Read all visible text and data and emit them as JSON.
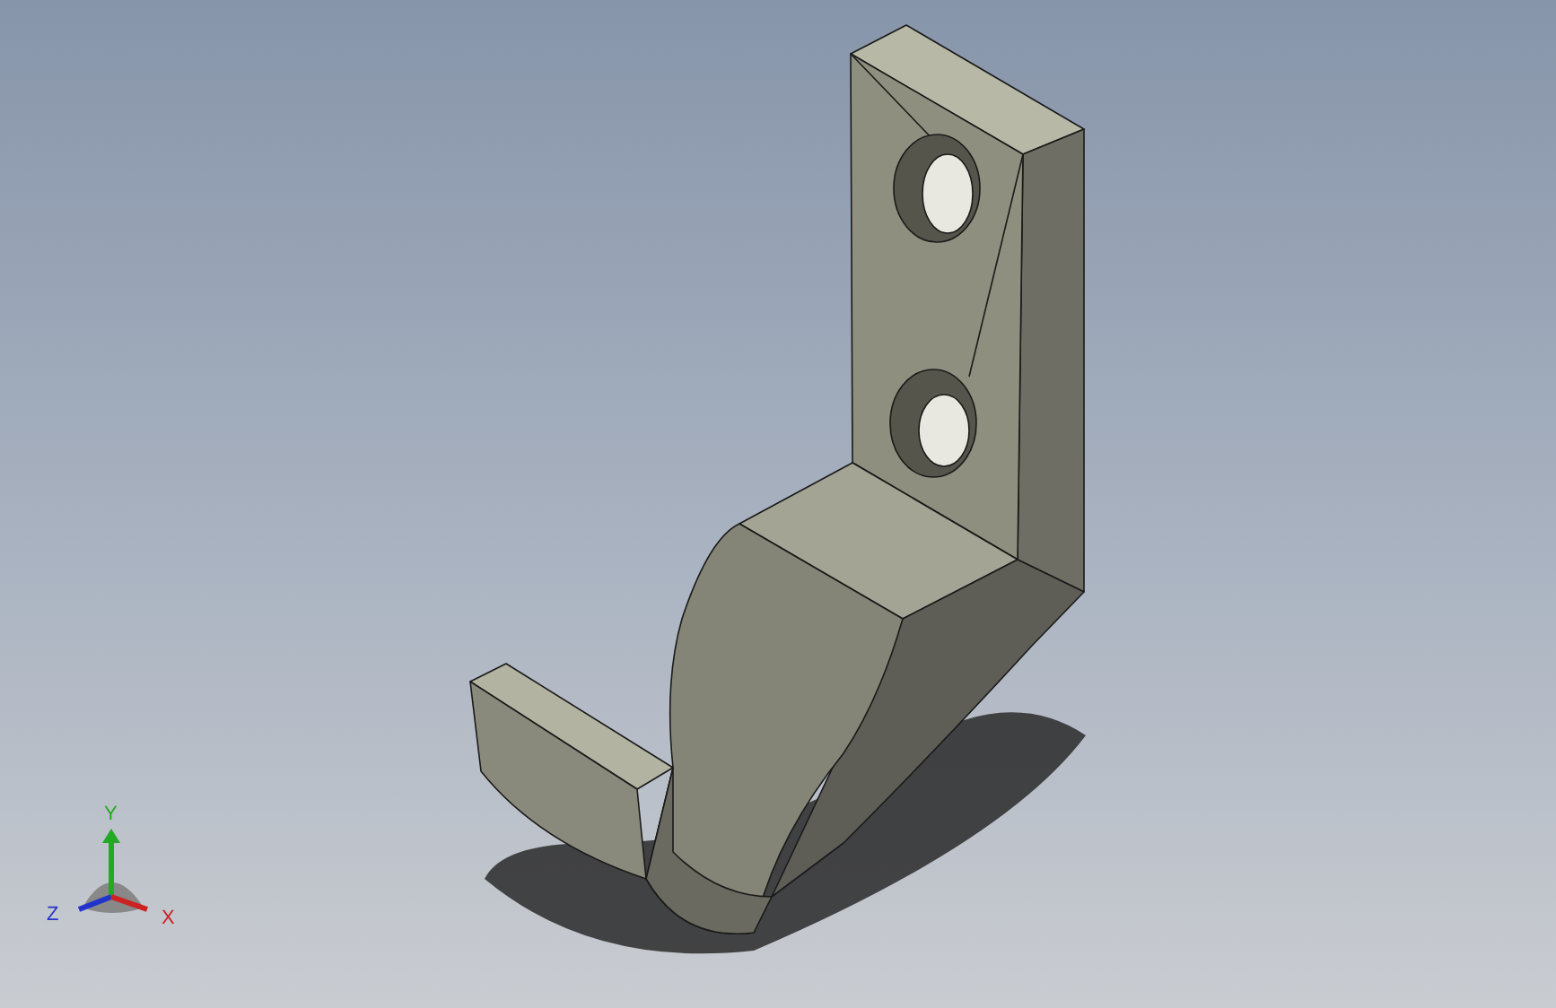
{
  "axis_triad": {
    "labels": [
      {
        "text": "Y",
        "color": "#22aa22"
      },
      {
        "text": "Z",
        "color": "#2233cc"
      },
      {
        "text": "X",
        "color": "#cc2222"
      }
    ]
  }
}
